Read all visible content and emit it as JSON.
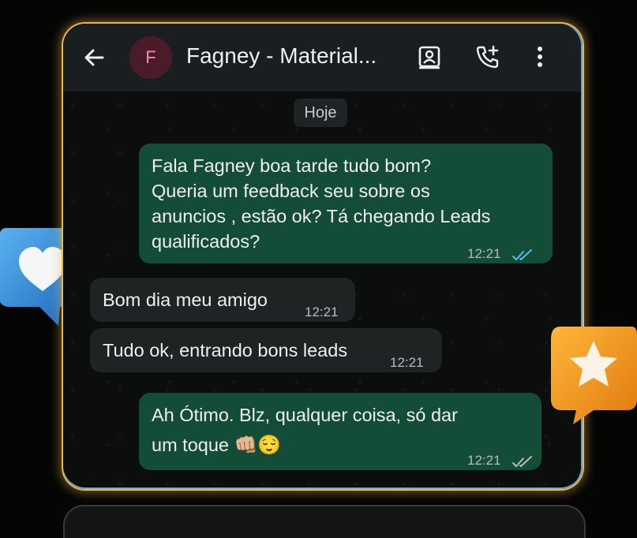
{
  "chat": {
    "contact_initial": "F",
    "contact_name": "Fagney - Material...",
    "date_label": "Hoje"
  },
  "messages": [
    {
      "direction": "outgoing",
      "lines": [
        "Fala Fagney boa tarde tudo bom?",
        "Queria um feedback seu sobre os",
        "anuncios , estão ok? Tá chegando Leads",
        "qualificados?"
      ],
      "time": "12:21",
      "status": "read"
    },
    {
      "direction": "incoming",
      "lines": [
        "Bom dia meu amigo"
      ],
      "time": "12:21"
    },
    {
      "direction": "incoming",
      "lines": [
        "Tudo ok, entrando bons leads"
      ],
      "time": "12:21"
    },
    {
      "direction": "outgoing",
      "lines": [
        "Ah Ótimo. Blz, qualquer coisa,  só dar",
        "um toque"
      ],
      "emoji": "👊🏼😌",
      "time": "12:21",
      "status": "delivered"
    }
  ],
  "icons": {
    "back": "arrow-left-icon",
    "contact_card": "contact-card-icon",
    "add_call": "add-call-icon",
    "menu": "more-vert-icon",
    "heart": "heart-icon",
    "star": "star-icon"
  },
  "colors": {
    "outgoing_bubble": "#134d37",
    "incoming_bubble": "#1f2324",
    "read_ticks": "#53bdeb",
    "border_glow": "#e9b84d"
  }
}
